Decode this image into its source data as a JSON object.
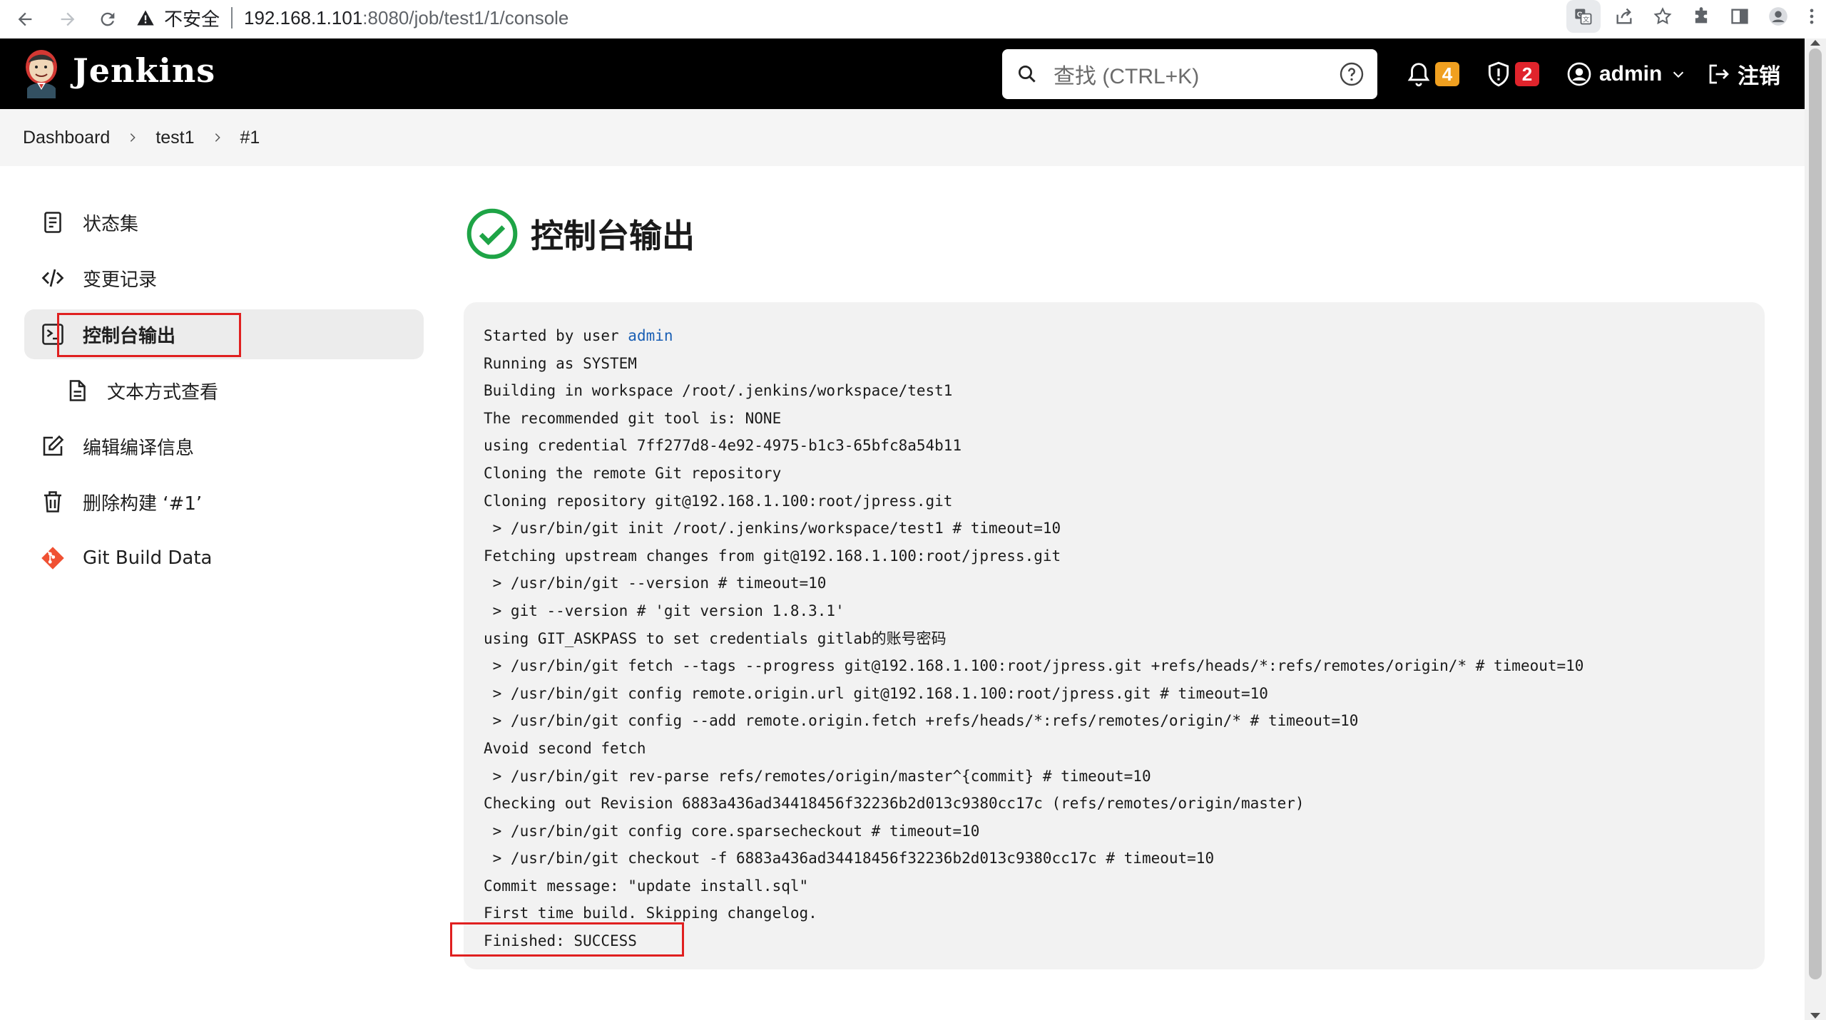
{
  "browser": {
    "insecure_label": "不安全",
    "url_host": "192.168.1.101",
    "url_path": ":8080/job/test1/1/console"
  },
  "header": {
    "logo_text": "Jenkins",
    "search_placeholder": "查找 (CTRL+K)",
    "notifications_count": "4",
    "security_count": "2",
    "user_name": "admin",
    "logout_label": "注销",
    "notif_color": "#f0a020",
    "security_color": "#e0242c"
  },
  "breadcrumbs": [
    "Dashboard",
    "test1",
    "#1"
  ],
  "sidebar": {
    "items": [
      {
        "label": "状态集",
        "icon": "document-icon"
      },
      {
        "label": "变更记录",
        "icon": "code-icon"
      },
      {
        "label": "控制台输出",
        "icon": "terminal-icon"
      },
      {
        "label": "文本方式查看",
        "icon": "file-icon"
      },
      {
        "label": "编辑编译信息",
        "icon": "edit-icon"
      },
      {
        "label": "删除构建 ‘#1’",
        "icon": "trash-icon"
      },
      {
        "label": "Git Build Data",
        "icon": "git-icon"
      }
    ]
  },
  "main": {
    "title": "控制台输出",
    "console": {
      "started_prefix": "Started by user ",
      "started_user": "admin",
      "lines": [
        "Running as SYSTEM",
        "Building in workspace /root/.jenkins/workspace/test1",
        "The recommended git tool is: NONE",
        "using credential 7ff277d8-4e92-4975-b1c3-65bfc8a54b11",
        "Cloning the remote Git repository",
        "Cloning repository git@192.168.1.100:root/jpress.git",
        " > /usr/bin/git init /root/.jenkins/workspace/test1 # timeout=10",
        "Fetching upstream changes from git@192.168.1.100:root/jpress.git",
        " > /usr/bin/git --version # timeout=10",
        " > git --version # 'git version 1.8.3.1'",
        "using GIT_ASKPASS to set credentials gitlab的账号密码",
        " > /usr/bin/git fetch --tags --progress git@192.168.1.100:root/jpress.git +refs/heads/*:refs/remotes/origin/* # timeout=10",
        " > /usr/bin/git config remote.origin.url git@192.168.1.100:root/jpress.git # timeout=10",
        " > /usr/bin/git config --add remote.origin.fetch +refs/heads/*:refs/remotes/origin/* # timeout=10",
        "Avoid second fetch",
        " > /usr/bin/git rev-parse refs/remotes/origin/master^{commit} # timeout=10",
        "Checking out Revision 6883a436ad34418456f32236b2d013c9380cc17c (refs/remotes/origin/master)",
        " > /usr/bin/git config core.sparsecheckout # timeout=10",
        " > /usr/bin/git checkout -f 6883a436ad34418456f32236b2d013c9380cc17c # timeout=10",
        "Commit message: \"update install.sql\"",
        "First time build. Skipping changelog.",
        "Finished: SUCCESS"
      ]
    }
  }
}
